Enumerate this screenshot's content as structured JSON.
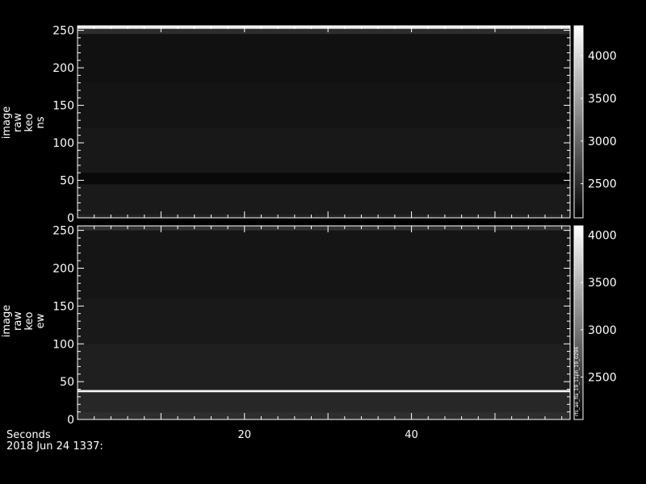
{
  "chart_data": [
    {
      "type": "heatmap",
      "ylabel_lines": [
        "image",
        "raw",
        "keo",
        "ns"
      ],
      "ylim": [
        0,
        256
      ],
      "yticks": [
        0,
        50,
        100,
        150,
        200,
        250
      ],
      "colorbar": {
        "range": [
          2100,
          4350
        ],
        "ticks": [
          2500,
          3000,
          3500,
          4000
        ]
      },
      "bands": [
        {
          "from": 0,
          "to": 5,
          "value": 2400
        },
        {
          "from": 5,
          "to": 45,
          "value": 2330
        },
        {
          "from": 45,
          "to": 60,
          "value": 2180
        },
        {
          "from": 60,
          "to": 120,
          "value": 2310
        },
        {
          "from": 120,
          "to": 180,
          "value": 2280
        },
        {
          "from": 180,
          "to": 245,
          "value": 2250
        },
        {
          "from": 245,
          "to": 252,
          "value": 2500
        },
        {
          "from": 252,
          "to": 256,
          "value": 4200
        }
      ]
    },
    {
      "type": "heatmap",
      "ylabel_lines": [
        "image",
        "raw",
        "keo",
        "ew"
      ],
      "ylim": [
        0,
        256
      ],
      "yticks": [
        0,
        50,
        100,
        150,
        200,
        250
      ],
      "colorbar": {
        "range": [
          2050,
          4100
        ],
        "ticks": [
          2500,
          3000,
          3500,
          4000
        ]
      },
      "colorbar_annotation": "rfs_ae_fla_19_11ph_19_0296",
      "bands": [
        {
          "from": 0,
          "to": 10,
          "value": 2420
        },
        {
          "from": 10,
          "to": 36,
          "value": 2360
        },
        {
          "from": 36,
          "to": 39,
          "value": 4000
        },
        {
          "from": 39,
          "to": 100,
          "value": 2300
        },
        {
          "from": 100,
          "to": 160,
          "value": 2250
        },
        {
          "from": 160,
          "to": 250,
          "value": 2220
        },
        {
          "from": 250,
          "to": 256,
          "value": 2450
        }
      ]
    }
  ],
  "x_axis": {
    "label": "Seconds",
    "date_label": "2018 Jun 24 1337:",
    "xlim": [
      0,
      59
    ],
    "ticks": [
      20,
      40
    ],
    "minor_step": 2
  }
}
